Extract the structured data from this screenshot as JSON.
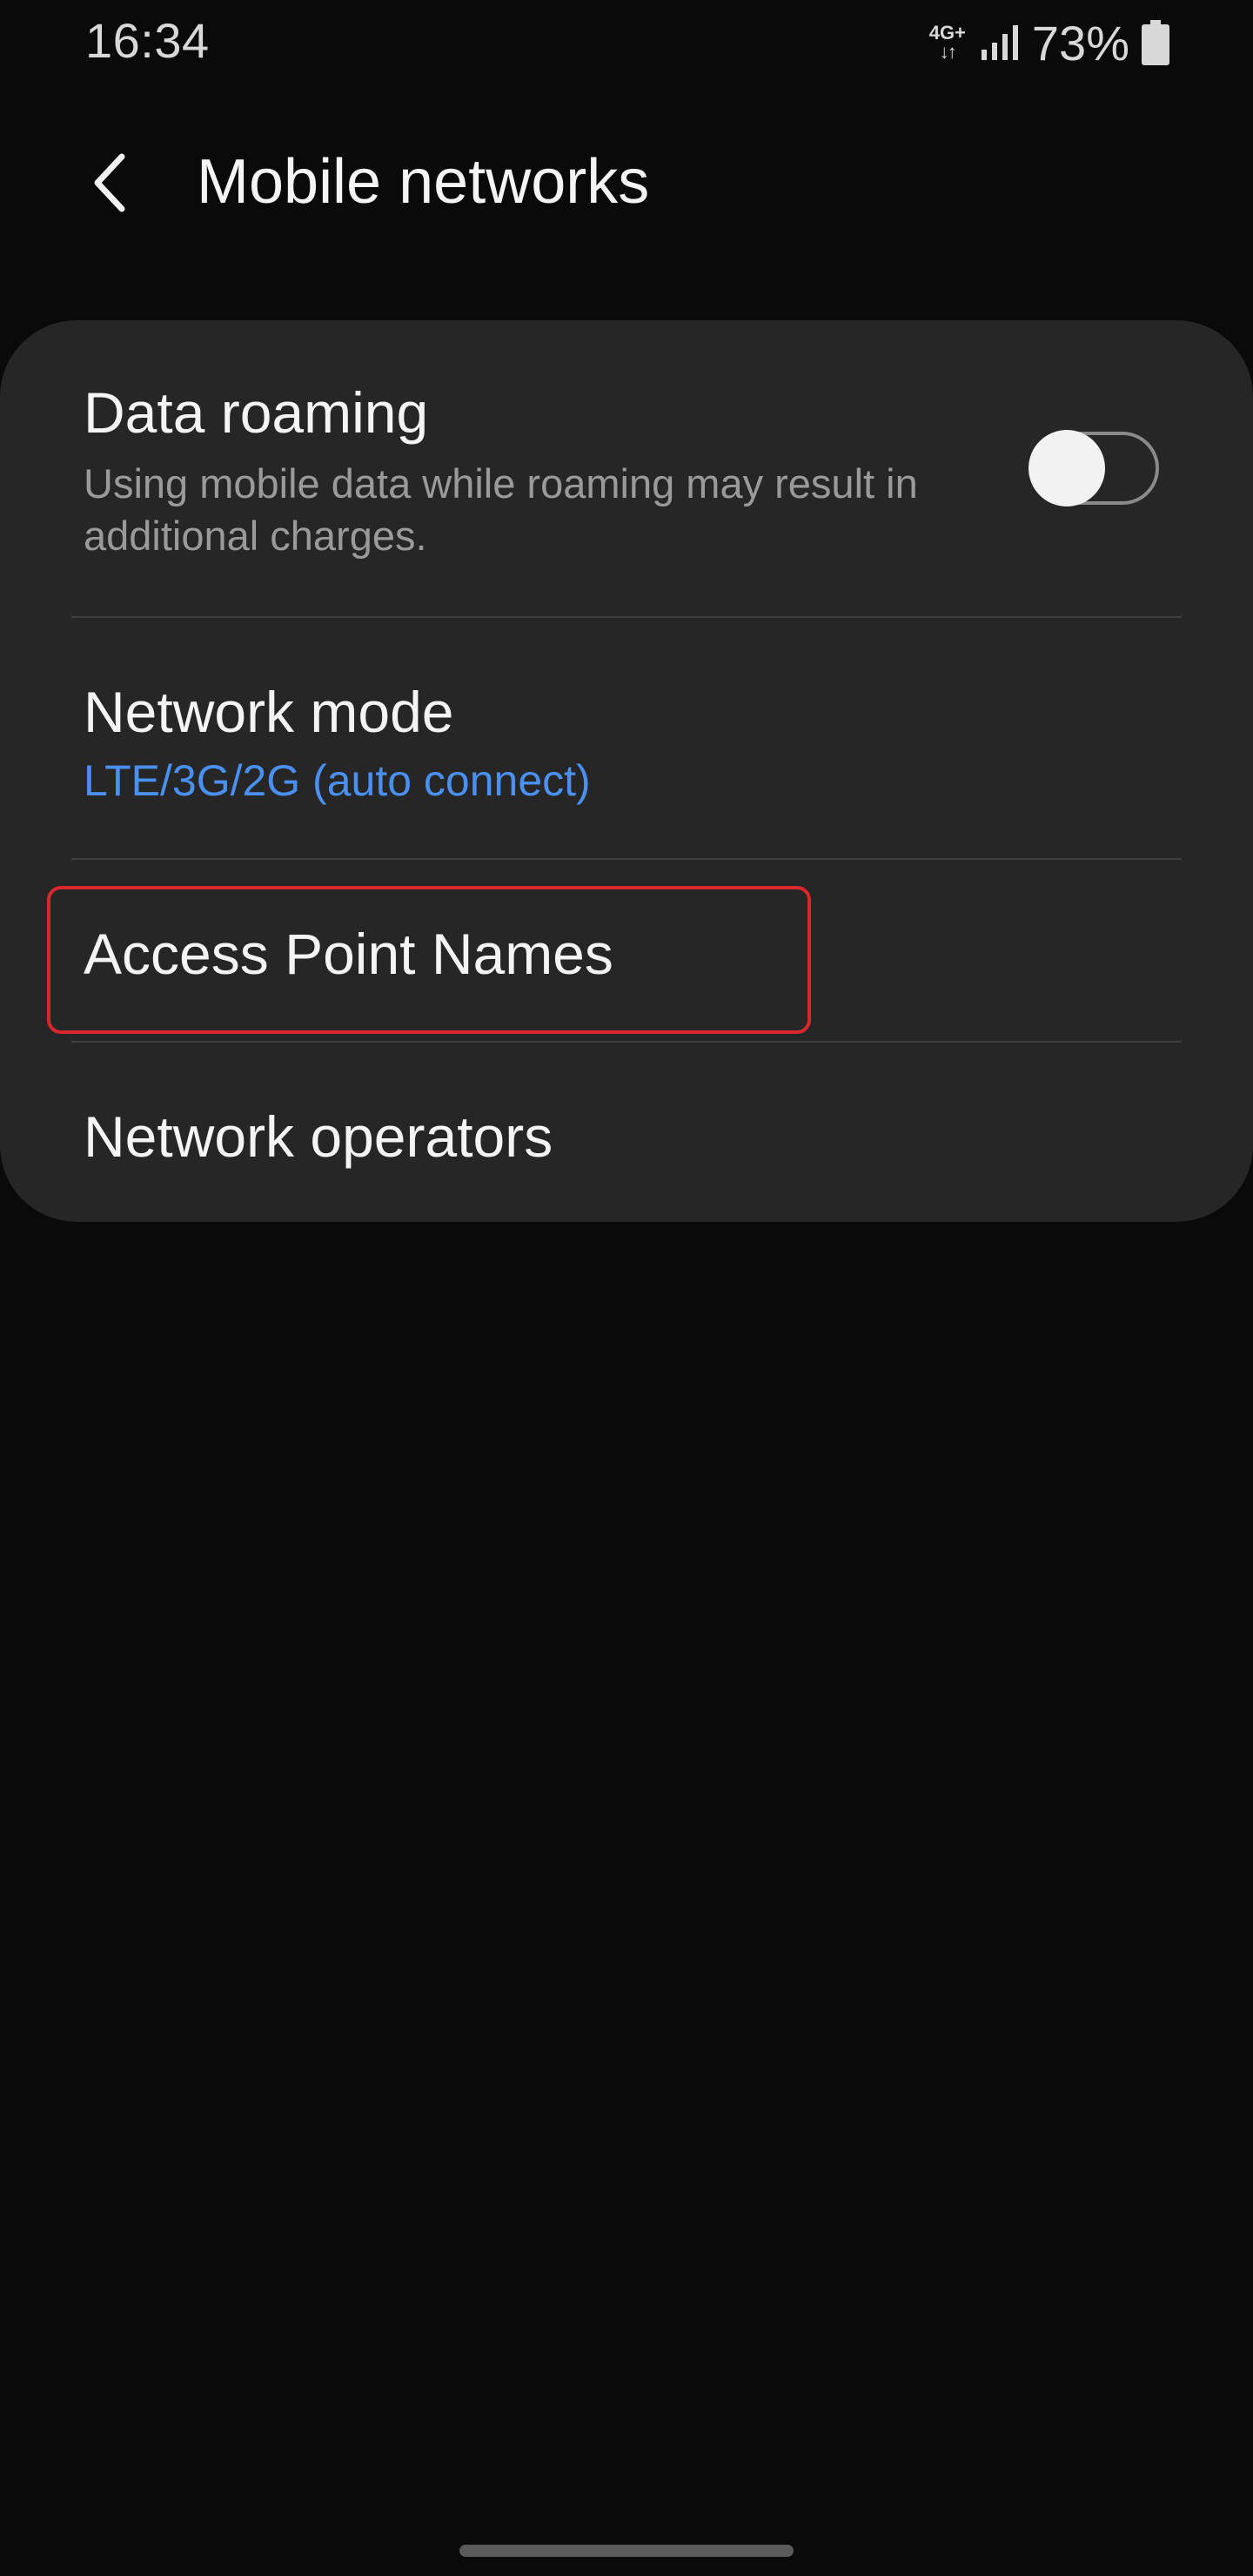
{
  "status_bar": {
    "time": "16:34",
    "network_type": "4G+",
    "battery_percent": "73%",
    "icons": [
      "network-activity-icon",
      "signal-icon",
      "battery-icon"
    ]
  },
  "header": {
    "title": "Mobile networks",
    "back_icon": "chevron-left-icon"
  },
  "settings": {
    "data_roaming": {
      "title": "Data roaming",
      "subtitle": "Using mobile data while roaming may result in additional charges.",
      "enabled": false
    },
    "network_mode": {
      "title": "Network mode",
      "value": "LTE/3G/2G (auto connect)"
    },
    "access_point_names": {
      "title": "Access Point Names"
    },
    "network_operators": {
      "title": "Network operators"
    }
  },
  "colors": {
    "background": "#0a0a0a",
    "card": "#262626",
    "accent": "#4a90f0",
    "highlight": "#d8282c"
  }
}
